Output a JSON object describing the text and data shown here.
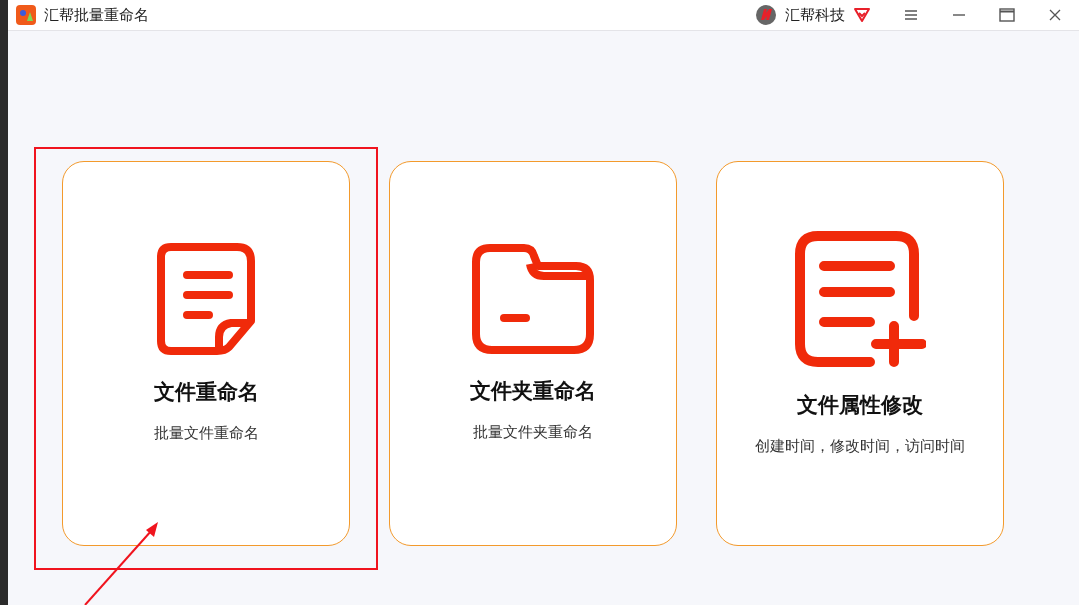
{
  "window": {
    "title": "汇帮批量重命名",
    "brand": "汇帮科技"
  },
  "cards": [
    {
      "kind": "file",
      "title": "文件重命名",
      "subtitle": "批量文件重命名",
      "highlighted": true
    },
    {
      "kind": "folder",
      "title": "文件夹重命名",
      "subtitle": "批量文件夹重命名",
      "highlighted": false
    },
    {
      "kind": "attributes",
      "title": "文件属性修改",
      "subtitle": "创建时间，修改时间，访问时间",
      "highlighted": false
    }
  ]
}
